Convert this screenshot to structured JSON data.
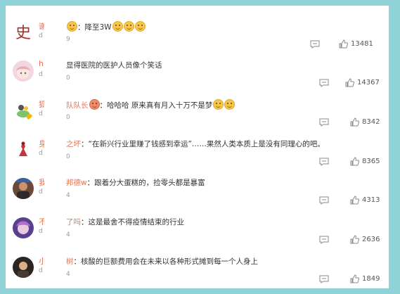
{
  "comments": [
    {
      "name_fragment": "谢",
      "sub_fragment": "d",
      "text_prefix": "：降至3W",
      "text_body": "",
      "emoji_count": 3,
      "time_fragment": "9",
      "likes": "13481",
      "avatar": "史"
    },
    {
      "name_fragment": "h",
      "sub_fragment": "d",
      "text_prefix": "",
      "text_body": "显得医院的医护人员像个笑话",
      "emoji_count": 0,
      "time_fragment": "0",
      "likes": "14367",
      "avatar": "anime-pink"
    },
    {
      "name_fragment": "狐",
      "sub_fragment": "d",
      "text_prefix": "队队长",
      "text_body": "：哈哈哈 原来真有月入十万不是梦",
      "emoji_count": 2,
      "time_fragment": "0",
      "likes": "8342",
      "avatar": "plant"
    },
    {
      "name_fragment": "身",
      "sub_fragment": "d",
      "text_prefix": "之坏",
      "text_body": "：“在新兴行业里赚了钱感到幸运”……果然人类本质上是没有同理心的吧。",
      "emoji_count": 0,
      "time_fragment": "0",
      "likes": "8365",
      "avatar": "figure-red"
    },
    {
      "name_fragment": "我",
      "sub_fragment": "d",
      "text_prefix": "邦德w",
      "text_body": "：跟着分大蛋糕的，捡零头都是暴富",
      "emoji_count": 0,
      "time_fragment": "4",
      "likes": "4313",
      "avatar": "dark-person"
    },
    {
      "name_fragment": "不",
      "sub_fragment": "d",
      "text_prefix": "了吗",
      "text_body": "：这是最舍不得疫情结束的行业",
      "emoji_count": 0,
      "time_fragment": "4",
      "likes": "2636",
      "avatar": "purple-anime"
    },
    {
      "name_fragment": "小",
      "sub_fragment": "d",
      "text_prefix": "树",
      "text_body": "：核酸的巨额费用会在未来以各种形式摊到每一个人身上",
      "emoji_count": 0,
      "time_fragment": "4",
      "likes": "1849",
      "avatar": "dark-photo"
    }
  ],
  "icons": {
    "reply": "comment-icon",
    "like": "thumbs-up-icon"
  },
  "colors": {
    "background": "#8fd3d8",
    "username": "#eb7350",
    "text": "#333333",
    "meta": "#999999"
  }
}
